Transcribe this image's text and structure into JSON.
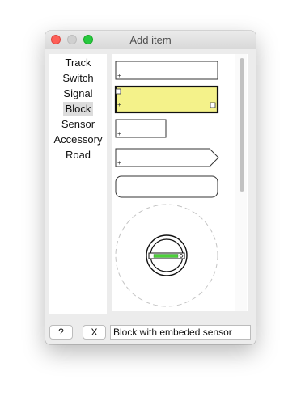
{
  "window": {
    "title": "Add item"
  },
  "categories": [
    {
      "label": "Track",
      "selected": false
    },
    {
      "label": "Switch",
      "selected": false
    },
    {
      "label": "Signal",
      "selected": false
    },
    {
      "label": "Block",
      "selected": true
    },
    {
      "label": "Sensor",
      "selected": false
    },
    {
      "label": "Accessory",
      "selected": false
    },
    {
      "label": "Road",
      "selected": false
    }
  ],
  "preview_items": [
    {
      "name": "block-plain",
      "selected": false
    },
    {
      "name": "block-with-embedded-sensor",
      "selected": true,
      "fill": "#f4f28a"
    },
    {
      "name": "block-short",
      "selected": false
    },
    {
      "name": "block-arrow",
      "selected": false
    },
    {
      "name": "block-rounded",
      "selected": false
    },
    {
      "name": "block-turntable",
      "selected": false,
      "indicator_color": "#4cd137"
    }
  ],
  "buttons": {
    "help_label": "?",
    "cancel_label": "X"
  },
  "description_field": {
    "value": "Block with embeded sensor"
  }
}
